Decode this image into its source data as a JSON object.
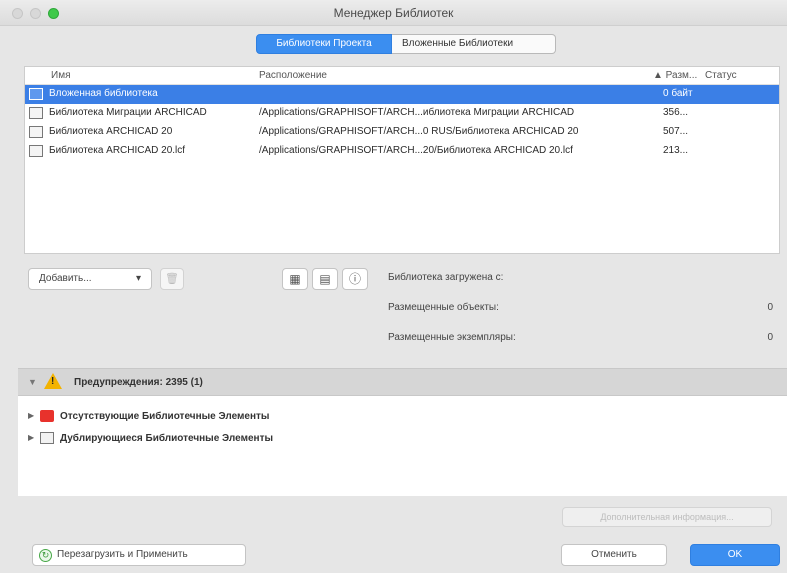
{
  "window": {
    "title": "Менеджер Библиотек"
  },
  "tabs": [
    {
      "label": "Библиотеки Проекта",
      "active": true
    },
    {
      "label": "Вложенные Библиотеки",
      "active": false
    }
  ],
  "table": {
    "columns": {
      "name": "Имя",
      "location": "Расположение",
      "size": "▲ Разм...",
      "status": "Статус"
    },
    "rows": [
      {
        "name": "Вложенная библиотека",
        "location": "",
        "size": "0 байт",
        "status": "",
        "selected": true
      },
      {
        "name": "Библиотека Миграции ARCHICAD",
        "location": "/Applications/GRAPHISOFT/ARCH...иблиотека Миграции ARCHICAD",
        "size": "356...",
        "status": "",
        "selected": false
      },
      {
        "name": "Библиотека ARCHICAD 20",
        "location": "/Applications/GRAPHISOFT/ARCH...0 RUS/Библиотека ARCHICAD 20",
        "size": "507...",
        "status": "",
        "selected": false
      },
      {
        "name": "Библиотека ARCHICAD 20.lcf",
        "location": "/Applications/GRAPHISOFT/ARCH...20/Библиотека ARCHICAD 20.lcf",
        "size": "213...",
        "status": "",
        "selected": false
      }
    ]
  },
  "toolbar": {
    "add_label": "Добавить...",
    "add_chevron": "▾",
    "trash_glyph": "🗑",
    "icon1": "▦",
    "icon2": "▤",
    "icon3": "ⓘ"
  },
  "info": {
    "loaded_label": "Библиотека загружена с:",
    "loaded_value": "",
    "objects_label": "Размещенные объекты:",
    "objects_value": "0",
    "textures_label": "Размещенные экземпляры:",
    "textures_value": "0"
  },
  "warnings": {
    "arrow": "▼",
    "title": "Предупреждения: 2395 (1)",
    "items": [
      {
        "arrow": "▶",
        "label": "Отсутствующие Библиотечные Элементы"
      },
      {
        "arrow": "▶",
        "label": "Дублирующиеся Библиотечные Элементы"
      }
    ]
  },
  "buttons": {
    "extra": "Дополнительная информация...",
    "reload": "Перезагрузить и Применить",
    "reload_icon": "↻",
    "cancel": "Отменить",
    "ok": "OK"
  },
  "colors": {
    "accent": "#3b8ef0",
    "selection": "#3b7fe6",
    "warning": "#f3b300",
    "missing_folder": "#e8322c"
  }
}
